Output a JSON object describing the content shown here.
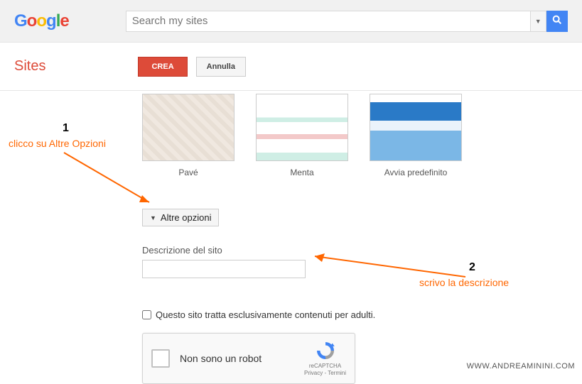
{
  "header": {
    "search_placeholder": "Search my sites"
  },
  "toolbar": {
    "title": "Sites",
    "create_label": "CREA",
    "cancel_label": "Annulla"
  },
  "themes": [
    {
      "name": "Pavé"
    },
    {
      "name": "Menta"
    },
    {
      "name": "Avvia predefinito"
    }
  ],
  "more_options_label": "Altre opzioni",
  "description_label": "Descrizione del sito",
  "adult_content_label": "Questo sito tratta esclusivamente contenuti per adulti.",
  "recaptcha": {
    "label": "Non sono un robot",
    "brand": "reCAPTCHA",
    "terms": "Privacy - Termini"
  },
  "annotations": {
    "n1": "1",
    "t1": "clicco su Altre Opzioni",
    "n2": "2",
    "t2": "scrivo la descrizione"
  },
  "watermark": "WWW.ANDREAMININI.COM"
}
